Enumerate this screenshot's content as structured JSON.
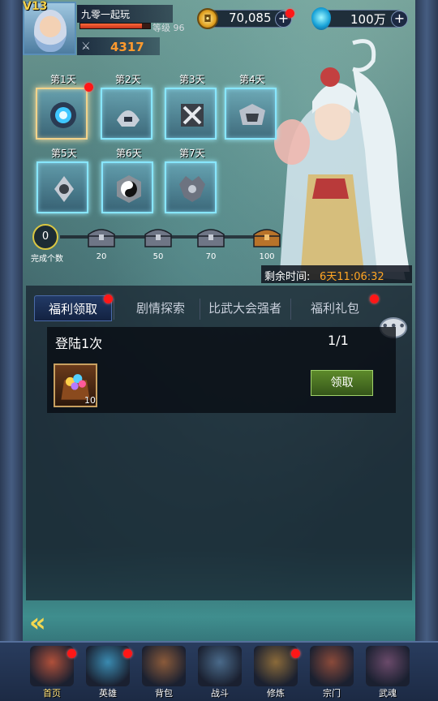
{
  "player": {
    "vip": "V13",
    "name": "九零一起玩",
    "level": "等级 96",
    "power": "4317",
    "hp_fraction": 0.88
  },
  "currency": {
    "gold": "70,085",
    "gems": "100万",
    "plus": "+"
  },
  "days": [
    {
      "label": "第1天",
      "icon": "blue-orb-icon",
      "active": true,
      "red_dot": true
    },
    {
      "label": "第2天",
      "icon": "silver-helmet-icon"
    },
    {
      "label": "第3天",
      "icon": "crossed-swords-shield-icon"
    },
    {
      "label": "第4天",
      "icon": "armor-chest-icon"
    },
    {
      "label": "第5天",
      "icon": "silver-emblem-icon"
    },
    {
      "label": "第6天",
      "icon": "yin-yang-icon"
    },
    {
      "label": "第7天",
      "icon": "winged-crest-icon"
    }
  ],
  "progress": {
    "count": "0",
    "caption": "完成个数",
    "milestones": [
      "20",
      "50",
      "70",
      "100"
    ]
  },
  "timer": {
    "label": "剩余时间:",
    "value": "6天11:06:32"
  },
  "tabs": [
    {
      "label": "福利领取",
      "active": true,
      "red_dot": true
    },
    {
      "label": "剧情探索"
    },
    {
      "label": "比武大会强者"
    },
    {
      "label": "福利礼包",
      "red_dot": true
    }
  ],
  "chat_icon": "•••",
  "task": {
    "title": "登陆1次",
    "progress": "1/1",
    "reward_count": "10",
    "claim_label": "领取"
  },
  "back_icon": "«",
  "nav": [
    {
      "label": "首页",
      "icon": "palace-icon",
      "active": true,
      "red_dot": true
    },
    {
      "label": "英雄",
      "icon": "hero-icon",
      "red_dot": true
    },
    {
      "label": "背包",
      "icon": "backpack-icon"
    },
    {
      "label": "战斗",
      "icon": "battle-icon"
    },
    {
      "label": "修炼",
      "icon": "training-icon",
      "red_dot": true
    },
    {
      "label": "宗门",
      "icon": "sect-icon"
    },
    {
      "label": "武魂",
      "icon": "martial-soul-icon"
    }
  ],
  "colors": {
    "accent_gold": "#f6d24a",
    "timer_orange": "#ffa524",
    "power_orange": "#ff9a2e",
    "claim_green": "#5d8a2a",
    "red_dot": "#ff1717"
  }
}
